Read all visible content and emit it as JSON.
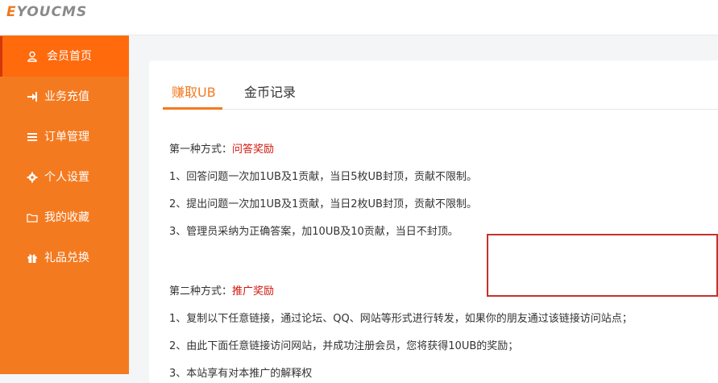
{
  "logo": {
    "initial": "E",
    "rest": "YOUCMS"
  },
  "sidebar": {
    "items": [
      {
        "label": "会员首页",
        "icon": "user-icon"
      },
      {
        "label": "业务充值",
        "icon": "sign-in-icon"
      },
      {
        "label": "订单管理",
        "icon": "list-icon"
      },
      {
        "label": "个人设置",
        "icon": "gear-icon"
      },
      {
        "label": "我的收藏",
        "icon": "folder-icon"
      },
      {
        "label": "礼品兑换",
        "icon": "gift-icon"
      }
    ]
  },
  "tabs": [
    {
      "label": "赚取UB"
    },
    {
      "label": "金币记录"
    }
  ],
  "content": {
    "method1_prefix": "第一种方式：",
    "method1_title": "问答奖励",
    "method1_lines": [
      "1、回答问题一次加1UB及1贡献，当日5枚UB封顶，贡献不限制。",
      "2、提出问题一次加1UB及1贡献，当日2枚UB封顶，贡献不限制。",
      "3、管理员采纳为正确答案，加10UB及10贡献，当日不封顶。"
    ],
    "method2_prefix": "第二种方式：",
    "method2_title": "推广奖励",
    "method2_lines": [
      "1、复制以下任意链接，通过论坛、QQ、网站等形式进行转发，如果你的朋友通过该链接访问站点；",
      "2、由此下面任意链接访问网站，并成功注册会员，您将获得10UB的奖励；",
      "3、本站享有对本推广的解释权"
    ]
  },
  "colors": {
    "accent": "#f47a20",
    "active_nav": "#ff6a0c",
    "highlight": "#d0160b",
    "annotation_box": "#c6312c"
  }
}
